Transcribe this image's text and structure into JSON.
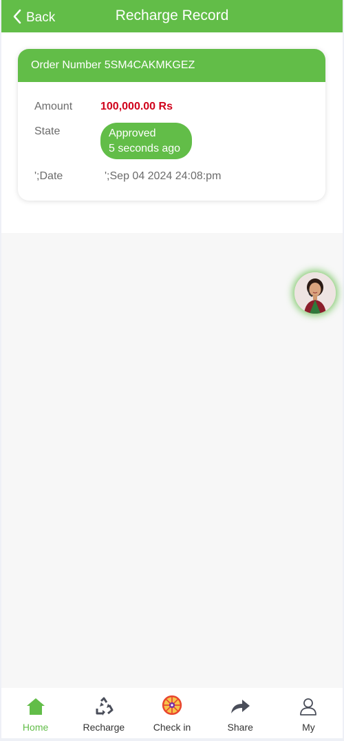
{
  "header": {
    "back_label": "Back",
    "title": "Recharge Record"
  },
  "record": {
    "order_label": "Order Number",
    "order_number": "5SM4CAKMKGEZ",
    "amount_label": "Amount",
    "amount_value": "100,000.00 Rs",
    "state_label": "State",
    "state_status": "Approved",
    "state_time": "5 seconds ago",
    "date_label": "';Date",
    "date_value": "';Sep 04 2024 24:08:pm"
  },
  "nav": {
    "items": [
      {
        "label": "Home",
        "icon": "home-icon",
        "active": true
      },
      {
        "label": "Recharge",
        "icon": "recycle-icon",
        "active": false
      },
      {
        "label": "Check in",
        "icon": "wheel-icon",
        "active": false
      },
      {
        "label": "Share",
        "icon": "share-arrow-icon",
        "active": false
      },
      {
        "label": "My",
        "icon": "user-icon",
        "active": false
      }
    ]
  },
  "colors": {
    "accent": "#62bd48",
    "amount": "#d0021b",
    "text_muted": "#6b6b6b",
    "background": "#f7f7f7"
  }
}
